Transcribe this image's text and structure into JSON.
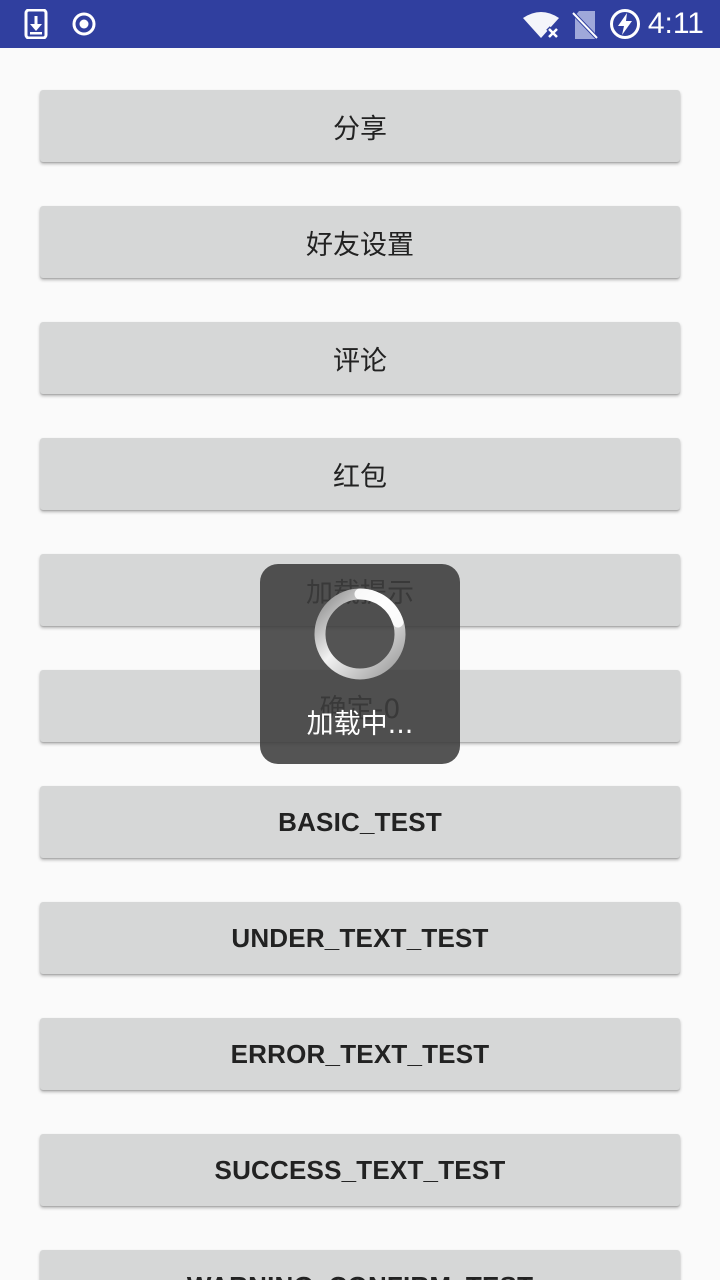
{
  "status_bar": {
    "time": "4:11",
    "icons": [
      "download-icon",
      "record-icon",
      "wifi-icon",
      "no-sim-icon",
      "battery-charging-icon"
    ],
    "background": "#303f9f"
  },
  "buttons": [
    {
      "label": "分享"
    },
    {
      "label": "好友设置"
    },
    {
      "label": "评论"
    },
    {
      "label": "红包"
    },
    {
      "label": "加载提示"
    },
    {
      "label": "确定-0"
    },
    {
      "label": "BASIC_TEST"
    },
    {
      "label": "UNDER_TEXT_TEST"
    },
    {
      "label": "ERROR_TEXT_TEST"
    },
    {
      "label": "SUCCESS_TEXT_TEST"
    },
    {
      "label": "WARNING_CONFIRM_TEST"
    }
  ],
  "loading_dialog": {
    "text": "加载中...",
    "icon": "loading-spinner-icon"
  },
  "colors": {
    "button_bg": "#d6d7d7",
    "page_bg": "#fafafa",
    "dialog_bg": "#3c3c3c"
  }
}
